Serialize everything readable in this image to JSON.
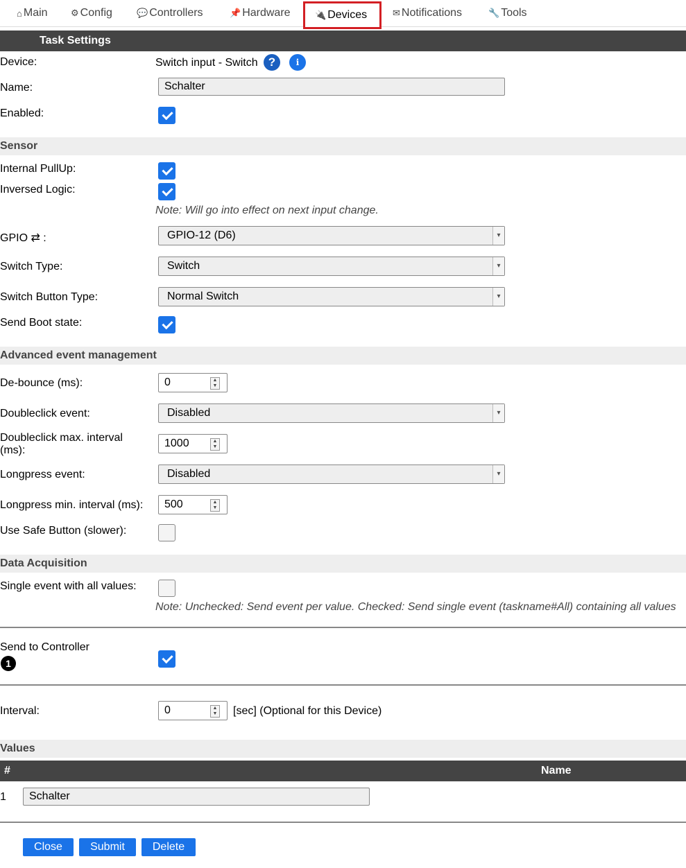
{
  "nav": {
    "tabs": [
      {
        "icon": "⌂",
        "label": "Main"
      },
      {
        "icon": "⚙",
        "label": "Config"
      },
      {
        "icon": "💬",
        "label": "Controllers"
      },
      {
        "icon": "📌",
        "label": "Hardware"
      },
      {
        "icon": "🔌",
        "label": "Devices"
      },
      {
        "icon": "✉",
        "label": "Notifications"
      },
      {
        "icon": "🔧",
        "label": "Tools"
      }
    ]
  },
  "task": {
    "header": "Task Settings",
    "device_label": "Device:",
    "device_value": "Switch input - Switch",
    "name_label": "Name:",
    "name_value": "Schalter",
    "enabled_label": "Enabled:",
    "enabled": true
  },
  "sensor": {
    "title": "Sensor",
    "pullup_label": "Internal PullUp:",
    "pullup": true,
    "inversed_label": "Inversed Logic:",
    "inversed": true,
    "note": "Note: Will go into effect on next input change.",
    "gpio_label": "GPIO ⇄ :",
    "gpio_value": "GPIO-12 (D6)",
    "switch_type_label": "Switch Type:",
    "switch_type_value": "Switch",
    "button_type_label": "Switch Button Type:",
    "button_type_value": "Normal Switch",
    "boot_label": "Send Boot state:",
    "boot": true
  },
  "advanced": {
    "title": "Advanced event management",
    "debounce_label": "De-bounce (ms):",
    "debounce_value": "0",
    "dblclick_label": "Doubleclick event:",
    "dblclick_value": "Disabled",
    "dblclick_int_label": "Doubleclick max. interval (ms):",
    "dblclick_int_value": "1000",
    "longpress_label": "Longpress event:",
    "longpress_value": "Disabled",
    "longpress_int_label": "Longpress min. interval (ms):",
    "longpress_int_value": "500",
    "safe_label": "Use Safe Button (slower):",
    "safe": false
  },
  "acq": {
    "title": "Data Acquisition",
    "single_label": "Single event with all values:",
    "single": false,
    "note": "Note: Unchecked: Send event per value. Checked: Send single event (taskname#All) containing all values",
    "send_label": "Send to Controller",
    "send_badge": "1",
    "send": true,
    "interval_label": "Interval:",
    "interval_value": "0",
    "interval_suffix": "[sec] (Optional for this Device)"
  },
  "values": {
    "title": "Values",
    "col_num": "#",
    "col_name": "Name",
    "rows": [
      {
        "num": "1",
        "name": "Schalter"
      }
    ]
  },
  "buttons": {
    "close": "Close",
    "submit": "Submit",
    "delete": "Delete"
  }
}
